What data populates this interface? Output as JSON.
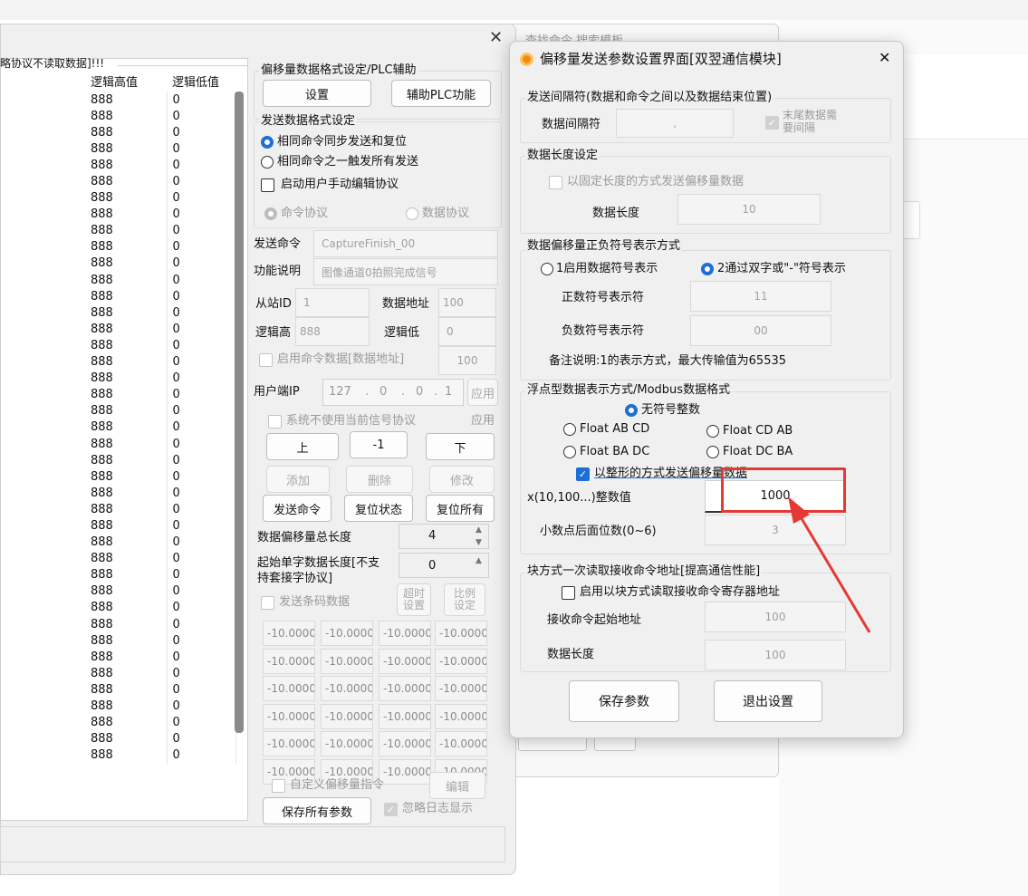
{
  "left_window": {
    "table": {
      "caption": "略协议不读取数据]!!!",
      "headers": [
        "逻辑高值",
        "逻辑低值"
      ],
      "rows": [
        [
          "888",
          "0"
        ],
        [
          "888",
          "0"
        ],
        [
          "888",
          "0"
        ],
        [
          "888",
          "0"
        ],
        [
          "888",
          "0"
        ],
        [
          "888",
          "0"
        ],
        [
          "888",
          "0"
        ],
        [
          "888",
          "0"
        ],
        [
          "888",
          "0"
        ],
        [
          "888",
          "0"
        ],
        [
          "888",
          "0"
        ],
        [
          "888",
          "0"
        ],
        [
          "888",
          "0"
        ],
        [
          "888",
          "0"
        ],
        [
          "888",
          "0"
        ],
        [
          "888",
          "0"
        ],
        [
          "888",
          "0"
        ],
        [
          "888",
          "0"
        ],
        [
          "888",
          "0"
        ],
        [
          "888",
          "0"
        ],
        [
          "888",
          "0"
        ],
        [
          "888",
          "0"
        ],
        [
          "888",
          "0"
        ],
        [
          "888",
          "0"
        ],
        [
          "888",
          "0"
        ],
        [
          "888",
          "0"
        ],
        [
          "888",
          "0"
        ],
        [
          "888",
          "0"
        ],
        [
          "888",
          "0"
        ],
        [
          "888",
          "0"
        ],
        [
          "888",
          "0"
        ],
        [
          "888",
          "0"
        ],
        [
          "888",
          "0"
        ],
        [
          "888",
          "0"
        ],
        [
          "888",
          "0"
        ],
        [
          "888",
          "0"
        ],
        [
          "888",
          "0"
        ],
        [
          "888",
          "0"
        ],
        [
          "888",
          "0"
        ],
        [
          "888",
          "0"
        ],
        [
          "888",
          "0"
        ]
      ]
    },
    "offset_group": {
      "title": "偏移量数据格式设定/PLC辅助",
      "setup_btn": "设置",
      "plc_btn": "辅助PLC功能"
    },
    "send_format": {
      "title": "发送数据格式设定",
      "radio1": "相同命令同步发送和复位",
      "radio2": "相同命令之一触发所有发送",
      "manual_edit": "启动用户手动编辑协议",
      "cmd_proto": "命令协议",
      "data_proto": "数据协议"
    },
    "send_cmd_label": "发送命令",
    "send_cmd_value": "CaptureFinish_00",
    "func_desc_label": "功能说明",
    "func_desc_value": "图像通道0拍照完成信号",
    "slave_id_label": "从站ID",
    "slave_id_value": "1",
    "data_addr_label": "数据地址",
    "data_addr_value": "100",
    "logic_high_label": "逻辑高",
    "logic_high_value": "888",
    "logic_low_label": "逻辑低",
    "logic_low_value": "0",
    "enable_cmd_data": "启用命令数据[数据地址]",
    "enable_cmd_data_value": "100",
    "client_ip_label": "用户端IP",
    "client_ip": [
      "127",
      "0",
      "0",
      "1"
    ],
    "apply1": "应用",
    "sys_no_use": "系统不使用当前信号协议",
    "apply2": "应用",
    "up_btn": "上",
    "minus_one": "-1",
    "down_btn": "下",
    "add_btn": "添加",
    "del_btn": "删除",
    "modify_btn": "修改",
    "send_cmd_btn": "发送命令",
    "reset_state_btn": "复位状态",
    "reset_all_btn": "复位所有",
    "offset_total_label": "数据偏移量总长度",
    "offset_total_value": "4",
    "start_word_label1": "起始单字数据长度[不支",
    "start_word_label2": "持套接字协议]",
    "start_word_value": "0",
    "send_barcode": "发送条码数据",
    "timeout_btn": "超时\n设置",
    "ratio_btn": "比例\n设定",
    "offset_cells": [
      [
        "-10.0000",
        "-10.0000",
        "-10.0000",
        "-10.0000"
      ],
      [
        "-10.0000",
        "-10.0000",
        "-10.0000",
        "-10.0000"
      ],
      [
        "-10.0000",
        "-10.0000",
        "-10.0000",
        "-10.0000"
      ],
      [
        "-10.0000",
        "-10.0000",
        "-10.0000",
        "-10.0000"
      ],
      [
        "-10.0000",
        "-10.0000",
        "-10.0000",
        "-10.0000"
      ],
      [
        "-10.0000",
        "-10.0000",
        "-10.0000",
        "-10.0000"
      ]
    ],
    "custom_offset": "自定义偏移量指令",
    "edit_btn": "编辑",
    "save_all_btn": "保存所有参数",
    "ignore_log": "忽略日志显示"
  },
  "bg_window": {
    "title_partial": "查找命令  搜索模板"
  },
  "dialog": {
    "title": "偏移量发送参数设置界面[双翌通信模块]",
    "close": "✕",
    "sep_group": {
      "title": "发送间隔符(数据和命令之间以及数据结束位置)",
      "sep_label": "数据间隔符",
      "sep_value": ",",
      "tail_label1": "末尾数据需",
      "tail_label2": "要间隔"
    },
    "len_group": {
      "title": "数据长度设定",
      "fixed_len": "以固定长度的方式发送偏移量数据",
      "len_label": "数据长度",
      "len_value": "10"
    },
    "sign_group": {
      "title": "数据偏移量正负符号表示方式",
      "opt1": "1启用数据符号表示",
      "opt2": "2通过双字或\"-\"符号表示",
      "pos_label": "正数符号表示符",
      "pos_value": "11",
      "neg_label": "负数符号表示符",
      "neg_value": "00",
      "note": "备注说明:1的表示方式，最大传输值为65535"
    },
    "float_group": {
      "title": "浮点型数据表示方式/Modbus数据格式",
      "unsigned": "无符号整数",
      "abcd": "Float AB CD",
      "cdab": "Float CD  AB",
      "badc": "Float BA DC",
      "dcba": "Float DC BA",
      "int_send": "以整形的方式发送偏移量数据",
      "int_label": "x(10,100...)整数值",
      "int_value": "1000",
      "dec_label": "小数点后面位数(0~6)",
      "dec_value": "3"
    },
    "block_group": {
      "title": "块方式一次读取接收命令地址[提高通信性能]",
      "enable": "启用以块方式读取接收命令寄存器地址",
      "start_label": "接收命令起始地址",
      "start_value": "100",
      "len_label": "数据长度",
      "len_value": "100"
    },
    "save_btn": "保存参数",
    "exit_btn": "退出设置"
  },
  "colors": {
    "accent": "#1c6fd6",
    "highlight": "#e53935"
  }
}
